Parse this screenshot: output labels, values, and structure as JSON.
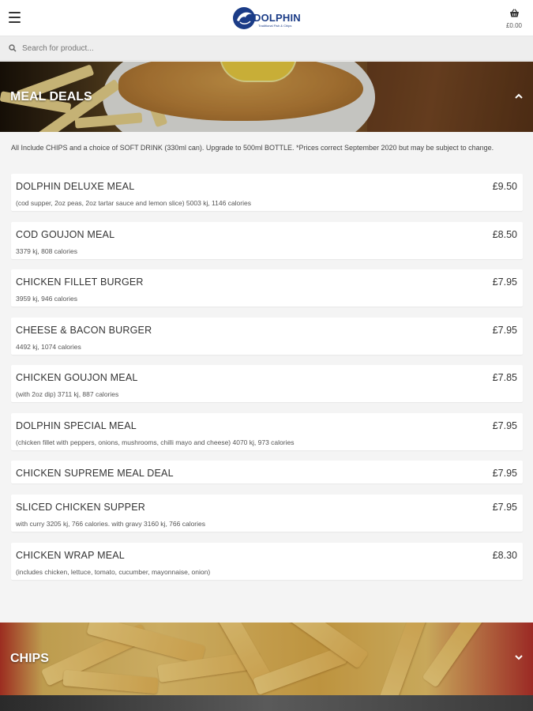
{
  "header": {
    "menu_icon": "hamburger-menu-icon",
    "logo_text": "DOLPHIN",
    "logo_tagline": "Traditional Fish & Chips",
    "basket_icon": "basket-icon",
    "basket_total": "£0.00"
  },
  "search": {
    "placeholder": "Search for product...",
    "icon": "search-icon"
  },
  "categories": [
    {
      "title": "MEAL DEALS",
      "expanded": true,
      "note": "All Include CHIPS and a choice of SOFT DRINK (330ml can). Upgrade to 500ml BOTTLE. *Prices correct September 2020 but may be subject to change.",
      "items": [
        {
          "name": "DOLPHIN DELUXE MEAL",
          "price": "£9.50",
          "desc": "(cod supper, 2oz peas, 2oz tartar sauce and lemon slice) 5003 kj, 1146 calories"
        },
        {
          "name": "COD GOUJON MEAL",
          "price": "£8.50",
          "desc": "3379 kj, 808 calories"
        },
        {
          "name": "CHICKEN FILLET BURGER",
          "price": "£7.95",
          "desc": "3959 kj, 946 calories"
        },
        {
          "name": "CHEESE & BACON BURGER",
          "price": "£7.95",
          "desc": "4492 kj, 1074 calories"
        },
        {
          "name": "CHICKEN GOUJON MEAL",
          "price": "£7.85",
          "desc": "(with 2oz dip) 3711 kj, 887 calories"
        },
        {
          "name": "DOLPHIN SPECIAL MEAL",
          "price": "£7.95",
          "desc": "(chicken fillet with peppers, onions, mushrooms, chilli mayo and cheese) 4070 kj, 973 calories"
        },
        {
          "name": "CHICKEN SUPREME MEAL DEAL",
          "price": "£7.95",
          "desc": ""
        },
        {
          "name": "SLICED CHICKEN SUPPER",
          "price": "£7.95",
          "desc": "with curry 3205 kj, 766 calories. with gravy 3160 kj, 766 calories"
        },
        {
          "name": "CHICKEN WRAP MEAL",
          "price": "£8.30",
          "desc": "(includes chicken, lettuce, tomato, cucumber, mayonnaise, onion)"
        }
      ]
    },
    {
      "title": "CHIPS",
      "expanded": false
    }
  ],
  "colors": {
    "brand": "#1b3c87",
    "background": "#f4f4f4",
    "card": "#ffffff"
  }
}
